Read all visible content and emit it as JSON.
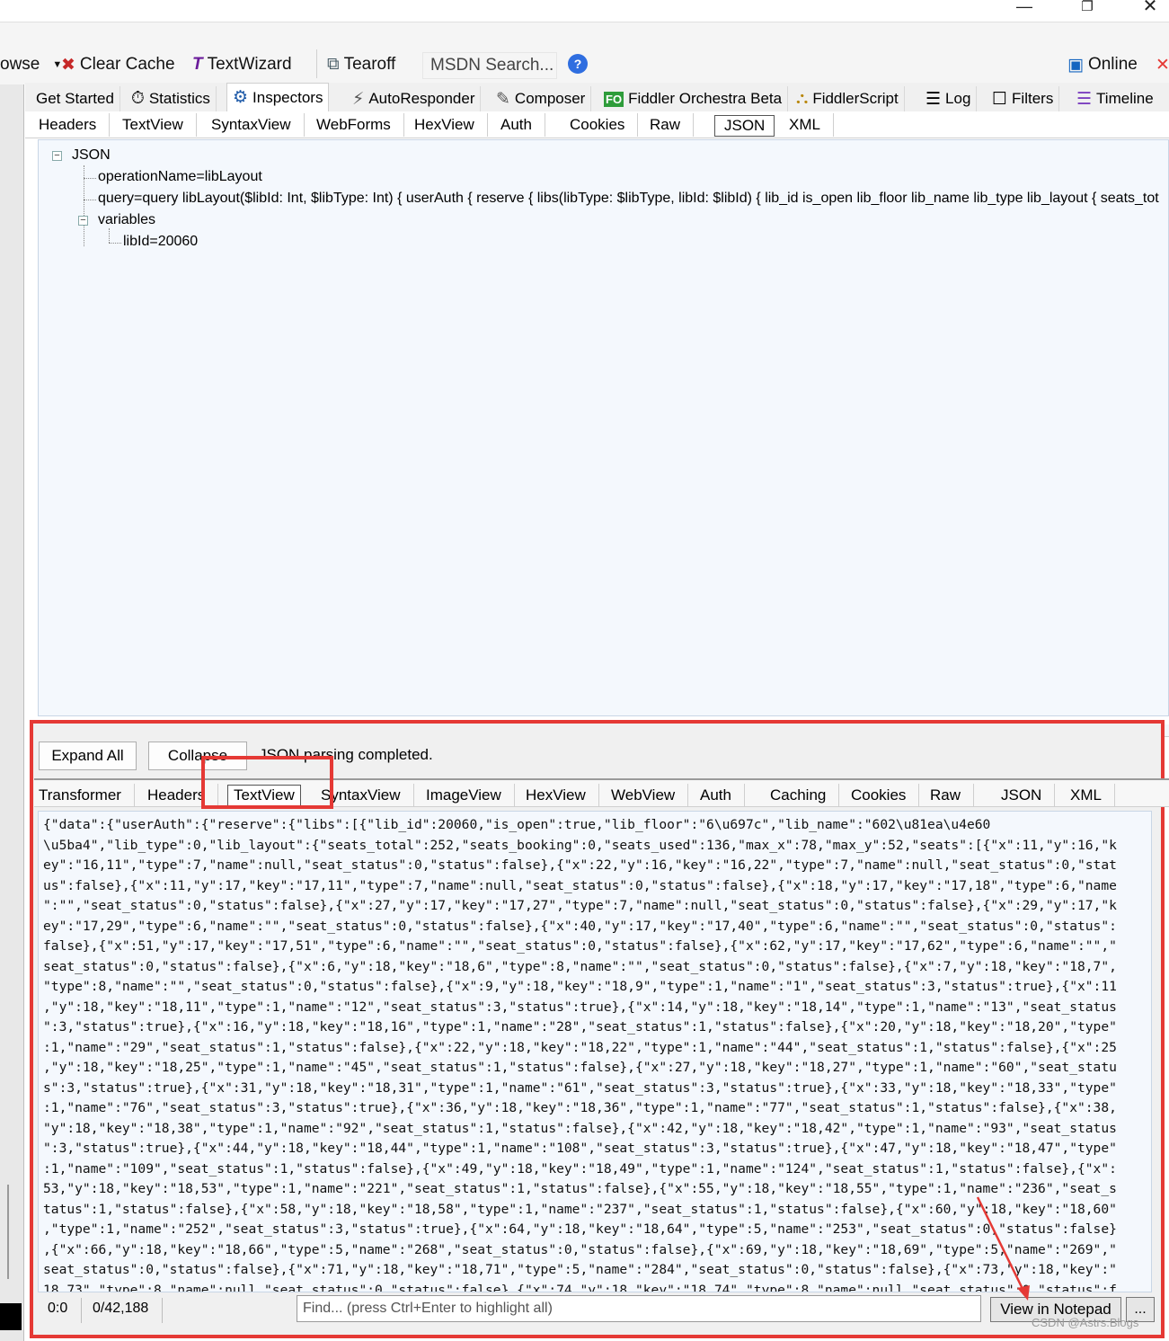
{
  "toolbar": {
    "browse_label": "owse",
    "clear_cache_label": "Clear Cache",
    "textwizard_label": "TextWizard",
    "tearoff_label": "Tearoff",
    "msdn_search_label": "MSDN Search...",
    "online_label": "Online"
  },
  "main_tabs": [
    "Get Started",
    "Statistics",
    "Inspectors",
    "AutoResponder",
    "Composer",
    "Fiddler Orchestra Beta",
    "FiddlerScript",
    "Log",
    "Filters",
    "Timeline"
  ],
  "request_tabs": [
    "Headers",
    "TextView",
    "SyntaxView",
    "WebForms",
    "HexView",
    "Auth",
    "Cookies",
    "Raw",
    "JSON",
    "XML"
  ],
  "tree": {
    "root": "JSON",
    "operation": "operationName=libLayout",
    "query": "query=query libLayout($libId: Int, $libType: Int) { userAuth { reserve { libs(libType: $libType, libId: $libId) { lib_id is_open lib_floor lib_name lib_type lib_layout { seats_tot",
    "variables": "variables",
    "libid": "libId=20060"
  },
  "lower": {
    "expand_all": "Expand All",
    "collapse": "Collapse",
    "status": "JSON parsing completed."
  },
  "response_tabs": [
    "Transformer",
    "Headers",
    "TextView",
    "SyntaxView",
    "ImageView",
    "HexView",
    "WebView",
    "Auth",
    "Caching",
    "Cookies",
    "Raw",
    "JSON",
    "XML"
  ],
  "response_text": [
    "{\"data\":{\"userAuth\":{\"reserve\":{\"libs\":[{\"lib_id\":20060,\"is_open\":true,\"lib_floor\":\"6\\u697c\",\"lib_name\":\"602\\u81ea\\u4e60",
    "\\u5ba4\",\"lib_type\":0,\"lib_layout\":{\"seats_total\":252,\"seats_booking\":0,\"seats_used\":136,\"max_x\":78,\"max_y\":52,\"seats\":[{\"x\":11,\"y\":16,\"k",
    "ey\":\"16,11\",\"type\":7,\"name\":null,\"seat_status\":0,\"status\":false},{\"x\":22,\"y\":16,\"key\":\"16,22\",\"type\":7,\"name\":null,\"seat_status\":0,\"stat",
    "us\":false},{\"x\":11,\"y\":17,\"key\":\"17,11\",\"type\":7,\"name\":null,\"seat_status\":0,\"status\":false},{\"x\":18,\"y\":17,\"key\":\"17,18\",\"type\":6,\"name",
    "\":\"\",\"seat_status\":0,\"status\":false},{\"x\":27,\"y\":17,\"key\":\"17,27\",\"type\":7,\"name\":null,\"seat_status\":0,\"status\":false},{\"x\":29,\"y\":17,\"k",
    "ey\":\"17,29\",\"type\":6,\"name\":\"\",\"seat_status\":0,\"status\":false},{\"x\":40,\"y\":17,\"key\":\"17,40\",\"type\":6,\"name\":\"\",\"seat_status\":0,\"status\":",
    "false},{\"x\":51,\"y\":17,\"key\":\"17,51\",\"type\":6,\"name\":\"\",\"seat_status\":0,\"status\":false},{\"x\":62,\"y\":17,\"key\":\"17,62\",\"type\":6,\"name\":\"\",\"",
    "seat_status\":0,\"status\":false},{\"x\":6,\"y\":18,\"key\":\"18,6\",\"type\":8,\"name\":\"\",\"seat_status\":0,\"status\":false},{\"x\":7,\"y\":18,\"key\":\"18,7\",",
    "\"type\":8,\"name\":\"\",\"seat_status\":0,\"status\":false},{\"x\":9,\"y\":18,\"key\":\"18,9\",\"type\":1,\"name\":\"1\",\"seat_status\":3,\"status\":true},{\"x\":11",
    ",\"y\":18,\"key\":\"18,11\",\"type\":1,\"name\":\"12\",\"seat_status\":3,\"status\":true},{\"x\":14,\"y\":18,\"key\":\"18,14\",\"type\":1,\"name\":\"13\",\"seat_status",
    "\":3,\"status\":true},{\"x\":16,\"y\":18,\"key\":\"18,16\",\"type\":1,\"name\":\"28\",\"seat_status\":1,\"status\":false},{\"x\":20,\"y\":18,\"key\":\"18,20\",\"type\"",
    ":1,\"name\":\"29\",\"seat_status\":1,\"status\":false},{\"x\":22,\"y\":18,\"key\":\"18,22\",\"type\":1,\"name\":\"44\",\"seat_status\":1,\"status\":false},{\"x\":25",
    ",\"y\":18,\"key\":\"18,25\",\"type\":1,\"name\":\"45\",\"seat_status\":1,\"status\":false},{\"x\":27,\"y\":18,\"key\":\"18,27\",\"type\":1,\"name\":\"60\",\"seat_statu",
    "s\":3,\"status\":true},{\"x\":31,\"y\":18,\"key\":\"18,31\",\"type\":1,\"name\":\"61\",\"seat_status\":3,\"status\":true},{\"x\":33,\"y\":18,\"key\":\"18,33\",\"type\"",
    ":1,\"name\":\"76\",\"seat_status\":3,\"status\":true},{\"x\":36,\"y\":18,\"key\":\"18,36\",\"type\":1,\"name\":\"77\",\"seat_status\":1,\"status\":false},{\"x\":38,",
    "\"y\":18,\"key\":\"18,38\",\"type\":1,\"name\":\"92\",\"seat_status\":1,\"status\":false},{\"x\":42,\"y\":18,\"key\":\"18,42\",\"type\":1,\"name\":\"93\",\"seat_status",
    "\":3,\"status\":true},{\"x\":44,\"y\":18,\"key\":\"18,44\",\"type\":1,\"name\":\"108\",\"seat_status\":3,\"status\":true},{\"x\":47,\"y\":18,\"key\":\"18,47\",\"type\"",
    ":1,\"name\":\"109\",\"seat_status\":1,\"status\":false},{\"x\":49,\"y\":18,\"key\":\"18,49\",\"type\":1,\"name\":\"124\",\"seat_status\":1,\"status\":false},{\"x\":",
    "53,\"y\":18,\"key\":\"18,53\",\"type\":1,\"name\":\"221\",\"seat_status\":1,\"status\":false},{\"x\":55,\"y\":18,\"key\":\"18,55\",\"type\":1,\"name\":\"236\",\"seat_s",
    "tatus\":1,\"status\":false},{\"x\":58,\"y\":18,\"key\":\"18,58\",\"type\":1,\"name\":\"237\",\"seat_status\":1,\"status\":false},{\"x\":60,\"y\":18,\"key\":\"18,60\"",
    ",\"type\":1,\"name\":\"252\",\"seat_status\":3,\"status\":true},{\"x\":64,\"y\":18,\"key\":\"18,64\",\"type\":5,\"name\":\"253\",\"seat_status\":0,\"status\":false}",
    ",{\"x\":66,\"y\":18,\"key\":\"18,66\",\"type\":5,\"name\":\"268\",\"seat_status\":0,\"status\":false},{\"x\":69,\"y\":18,\"key\":\"18,69\",\"type\":5,\"name\":\"269\",\"",
    "seat_status\":0,\"status\":false},{\"x\":71,\"y\":18,\"key\":\"18,71\",\"type\":5,\"name\":\"284\",\"seat_status\":0,\"status\":false},{\"x\":73,\"y\":18,\"key\":\"",
    "18,73\",\"type\":8,\"name\":null,\"seat_status\":0,\"status\":false},{\"x\":74,\"y\":18,\"key\":\"18,74\",\"type\":8,\"name\":null,\"seat_status\":0,\"status\":f"
  ],
  "footer": {
    "cursor": "0:0",
    "position": "0/42,188",
    "find_placeholder": "Find... (press Ctrl+Enter to highlight all)",
    "view_in_notepad": "View in Notepad",
    "more": "...",
    "watermark": "CSDN @Astrs.Blogs"
  },
  "colors": {
    "highlight_red": "#e53935",
    "panel_bg": "#f4f8fd",
    "toolbar_bg": "#f5f5f5"
  }
}
